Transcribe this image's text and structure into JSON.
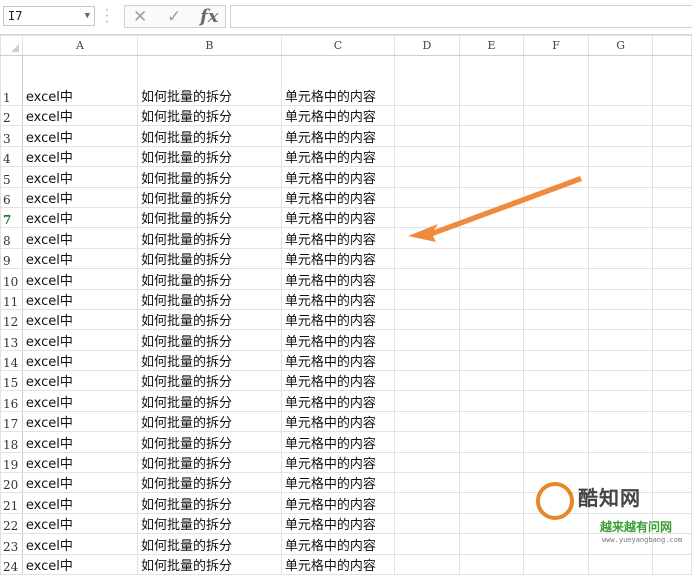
{
  "name_box": "I7",
  "formula_buttons": {
    "cancel": "✕",
    "enter": "✓",
    "fx": "fx"
  },
  "formula_value": "",
  "columns": [
    "A",
    "B",
    "C",
    "D",
    "E",
    "F",
    "G"
  ],
  "active_row": 7,
  "rows": [
    {
      "n": "1",
      "a": "excel中",
      "b": "如何批量的拆分",
      "c": "单元格中的内容"
    },
    {
      "n": "2",
      "a": "excel中",
      "b": "如何批量的拆分",
      "c": "单元格中的内容"
    },
    {
      "n": "3",
      "a": "excel中",
      "b": "如何批量的拆分",
      "c": "单元格中的内容"
    },
    {
      "n": "4",
      "a": "excel中",
      "b": "如何批量的拆分",
      "c": "单元格中的内容"
    },
    {
      "n": "5",
      "a": "excel中",
      "b": "如何批量的拆分",
      "c": "单元格中的内容"
    },
    {
      "n": "6",
      "a": "excel中",
      "b": "如何批量的拆分",
      "c": "单元格中的内容"
    },
    {
      "n": "7",
      "a": "excel中",
      "b": "如何批量的拆分",
      "c": "单元格中的内容"
    },
    {
      "n": "8",
      "a": "excel中",
      "b": "如何批量的拆分",
      "c": "单元格中的内容"
    },
    {
      "n": "9",
      "a": "excel中",
      "b": "如何批量的拆分",
      "c": "单元格中的内容"
    },
    {
      "n": "10",
      "a": "excel中",
      "b": "如何批量的拆分",
      "c": "单元格中的内容"
    },
    {
      "n": "11",
      "a": "excel中",
      "b": "如何批量的拆分",
      "c": "单元格中的内容"
    },
    {
      "n": "12",
      "a": "excel中",
      "b": "如何批量的拆分",
      "c": "单元格中的内容"
    },
    {
      "n": "13",
      "a": "excel中",
      "b": "如何批量的拆分",
      "c": "单元格中的内容"
    },
    {
      "n": "14",
      "a": "excel中",
      "b": "如何批量的拆分",
      "c": "单元格中的内容"
    },
    {
      "n": "15",
      "a": "excel中",
      "b": "如何批量的拆分",
      "c": "单元格中的内容"
    },
    {
      "n": "16",
      "a": "excel中",
      "b": "如何批量的拆分",
      "c": "单元格中的内容"
    },
    {
      "n": "17",
      "a": "excel中",
      "b": "如何批量的拆分",
      "c": "单元格中的内容"
    },
    {
      "n": "18",
      "a": "excel中",
      "b": "如何批量的拆分",
      "c": "单元格中的内容"
    },
    {
      "n": "19",
      "a": "excel中",
      "b": "如何批量的拆分",
      "c": "单元格中的内容"
    },
    {
      "n": "20",
      "a": "excel中",
      "b": "如何批量的拆分",
      "c": "单元格中的内容"
    },
    {
      "n": "21",
      "a": "excel中",
      "b": "如何批量的拆分",
      "c": "单元格中的内容"
    },
    {
      "n": "22",
      "a": "excel中",
      "b": "如何批量的拆分",
      "c": "单元格中的内容"
    },
    {
      "n": "23",
      "a": "excel中",
      "b": "如何批量的拆分",
      "c": "单元格中的内容"
    },
    {
      "n": "24",
      "a": "excel中",
      "b": "如何批量的拆分",
      "c": "单元格中的内容"
    }
  ],
  "annotation_arrow_color": "#f08a3c",
  "watermark": {
    "title": "酷知网",
    "subtitle": "越来越有问网",
    "url": "www.yueyangbang.com"
  }
}
